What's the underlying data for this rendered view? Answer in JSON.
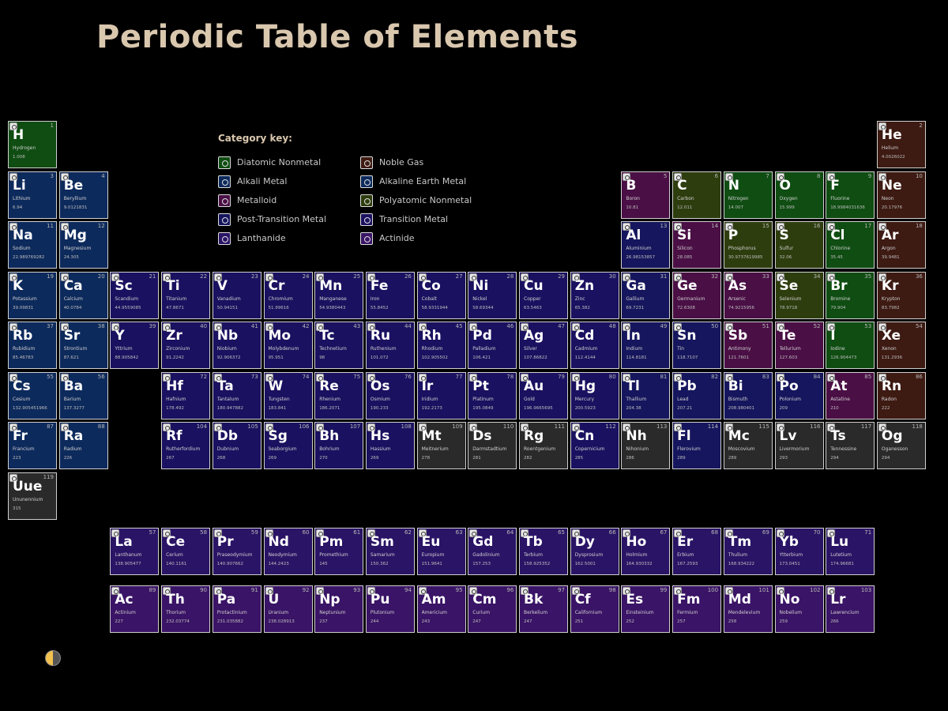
{
  "page": {
    "title": "Periodic Table of Elements"
  },
  "key": {
    "title": "Category key:",
    "items": [
      {
        "id": "dn",
        "label": "Diatomic Nonmetal"
      },
      {
        "id": "am",
        "label": "Alkali Metal"
      },
      {
        "id": "md",
        "label": "Metalloid"
      },
      {
        "id": "pt",
        "label": "Post-Transition Metal"
      },
      {
        "id": "ln",
        "label": "Lanthanide"
      },
      {
        "id": "ng",
        "label": "Noble Gas"
      },
      {
        "id": "ae",
        "label": "Alkaline Earth Metal"
      },
      {
        "id": "pn",
        "label": "Polyatomic Nonmetal"
      },
      {
        "id": "tm",
        "label": "Transition Metal"
      },
      {
        "id": "ac",
        "label": "Actinide"
      }
    ]
  },
  "colors": {
    "dn": "#0f4d12",
    "am": "#0d2a5c",
    "md": "#4a0f45",
    "pt": "#16165e",
    "ln": "#2a1466",
    "ng": "#3d1a12",
    "ae": "#0d2a5c",
    "pn": "#2e3d0e",
    "tm": "#1a1160",
    "ac": "#3a1466",
    "un": "#2a2a2a"
  },
  "elements": [
    {
      "n": 1,
      "s": "H",
      "name": "Hydrogen",
      "mass": "1.008",
      "c": "dn",
      "r": 1,
      "g": 1
    },
    {
      "n": 2,
      "s": "He",
      "name": "Helium",
      "mass": "4.0026022",
      "c": "ng",
      "r": 1,
      "g": 18
    },
    {
      "n": 3,
      "s": "Li",
      "name": "Lithium",
      "mass": "6.94",
      "c": "am",
      "r": 2,
      "g": 1
    },
    {
      "n": 4,
      "s": "Be",
      "name": "Beryllium",
      "mass": "9.0121831",
      "c": "ae",
      "r": 2,
      "g": 2
    },
    {
      "n": 5,
      "s": "B",
      "name": "Boron",
      "mass": "10.81",
      "c": "md",
      "r": 2,
      "g": 13
    },
    {
      "n": 6,
      "s": "C",
      "name": "Carbon",
      "mass": "12.011",
      "c": "pn",
      "r": 2,
      "g": 14
    },
    {
      "n": 7,
      "s": "N",
      "name": "Nitrogen",
      "mass": "14.007",
      "c": "dn",
      "r": 2,
      "g": 15
    },
    {
      "n": 8,
      "s": "O",
      "name": "Oxygen",
      "mass": "15.999",
      "c": "dn",
      "r": 2,
      "g": 16
    },
    {
      "n": 9,
      "s": "F",
      "name": "Fluorine",
      "mass": "18.9984031636",
      "c": "dn",
      "r": 2,
      "g": 17
    },
    {
      "n": 10,
      "s": "Ne",
      "name": "Neon",
      "mass": "20.17976",
      "c": "ng",
      "r": 2,
      "g": 18
    },
    {
      "n": 11,
      "s": "Na",
      "name": "Sodium",
      "mass": "22.989769282",
      "c": "am",
      "r": 3,
      "g": 1
    },
    {
      "n": 12,
      "s": "Mg",
      "name": "Magnesium",
      "mass": "24.305",
      "c": "ae",
      "r": 3,
      "g": 2
    },
    {
      "n": 13,
      "s": "Al",
      "name": "Aluminium",
      "mass": "26.98153857",
      "c": "pt",
      "r": 3,
      "g": 13
    },
    {
      "n": 14,
      "s": "Si",
      "name": "Silicon",
      "mass": "28.085",
      "c": "md",
      "r": 3,
      "g": 14
    },
    {
      "n": 15,
      "s": "P",
      "name": "Phosphorus",
      "mass": "30.9737619985",
      "c": "pn",
      "r": 3,
      "g": 15
    },
    {
      "n": 16,
      "s": "S",
      "name": "Sulfur",
      "mass": "32.06",
      "c": "pn",
      "r": 3,
      "g": 16
    },
    {
      "n": 17,
      "s": "Cl",
      "name": "Chlorine",
      "mass": "35.45",
      "c": "dn",
      "r": 3,
      "g": 17
    },
    {
      "n": 18,
      "s": "Ar",
      "name": "Argon",
      "mass": "39.9481",
      "c": "ng",
      "r": 3,
      "g": 18
    },
    {
      "n": 19,
      "s": "K",
      "name": "Potassium",
      "mass": "39.09831",
      "c": "am",
      "r": 4,
      "g": 1
    },
    {
      "n": 20,
      "s": "Ca",
      "name": "Calcium",
      "mass": "40.0784",
      "c": "ae",
      "r": 4,
      "g": 2
    },
    {
      "n": 21,
      "s": "Sc",
      "name": "Scandium",
      "mass": "44.9559085",
      "c": "tm",
      "r": 4,
      "g": 3
    },
    {
      "n": 22,
      "s": "Ti",
      "name": "Titanium",
      "mass": "47.8671",
      "c": "tm",
      "r": 4,
      "g": 4
    },
    {
      "n": 23,
      "s": "V",
      "name": "Vanadium",
      "mass": "50.94151",
      "c": "tm",
      "r": 4,
      "g": 5
    },
    {
      "n": 24,
      "s": "Cr",
      "name": "Chromium",
      "mass": "51.99616",
      "c": "tm",
      "r": 4,
      "g": 6
    },
    {
      "n": 25,
      "s": "Mn",
      "name": "Manganese",
      "mass": "54.9380443",
      "c": "tm",
      "r": 4,
      "g": 7
    },
    {
      "n": 26,
      "s": "Fe",
      "name": "Iron",
      "mass": "55.8452",
      "c": "tm",
      "r": 4,
      "g": 8
    },
    {
      "n": 27,
      "s": "Co",
      "name": "Cobalt",
      "mass": "58.9331944",
      "c": "tm",
      "r": 4,
      "g": 9
    },
    {
      "n": 28,
      "s": "Ni",
      "name": "Nickel",
      "mass": "58.69344",
      "c": "tm",
      "r": 4,
      "g": 10
    },
    {
      "n": 29,
      "s": "Cu",
      "name": "Copper",
      "mass": "63.5463",
      "c": "tm",
      "r": 4,
      "g": 11
    },
    {
      "n": 30,
      "s": "Zn",
      "name": "Zinc",
      "mass": "65.382",
      "c": "tm",
      "r": 4,
      "g": 12
    },
    {
      "n": 31,
      "s": "Ga",
      "name": "Gallium",
      "mass": "69.7231",
      "c": "pt",
      "r": 4,
      "g": 13
    },
    {
      "n": 32,
      "s": "Ge",
      "name": "Germanium",
      "mass": "72.6308",
      "c": "md",
      "r": 4,
      "g": 14
    },
    {
      "n": 33,
      "s": "As",
      "name": "Arsenic",
      "mass": "74.9215956",
      "c": "md",
      "r": 4,
      "g": 15
    },
    {
      "n": 34,
      "s": "Se",
      "name": "Selenium",
      "mass": "78.9718",
      "c": "pn",
      "r": 4,
      "g": 16
    },
    {
      "n": 35,
      "s": "Br",
      "name": "Bromine",
      "mass": "79.904",
      "c": "dn",
      "r": 4,
      "g": 17
    },
    {
      "n": 36,
      "s": "Kr",
      "name": "Krypton",
      "mass": "83.7982",
      "c": "ng",
      "r": 4,
      "g": 18
    },
    {
      "n": 37,
      "s": "Rb",
      "name": "Rubidium",
      "mass": "85.46783",
      "c": "am",
      "r": 5,
      "g": 1
    },
    {
      "n": 38,
      "s": "Sr",
      "name": "Strontium",
      "mass": "87.621",
      "c": "ae",
      "r": 5,
      "g": 2
    },
    {
      "n": 39,
      "s": "Y",
      "name": "Yttrium",
      "mass": "88.905842",
      "c": "tm",
      "r": 5,
      "g": 3
    },
    {
      "n": 40,
      "s": "Zr",
      "name": "Zirconium",
      "mass": "91.2242",
      "c": "tm",
      "r": 5,
      "g": 4
    },
    {
      "n": 41,
      "s": "Nb",
      "name": "Niobium",
      "mass": "92.906372",
      "c": "tm",
      "r": 5,
      "g": 5
    },
    {
      "n": 42,
      "s": "Mo",
      "name": "Molybdenum",
      "mass": "95.951",
      "c": "tm",
      "r": 5,
      "g": 6
    },
    {
      "n": 43,
      "s": "Tc",
      "name": "Technetium",
      "mass": "98",
      "c": "tm",
      "r": 5,
      "g": 7
    },
    {
      "n": 44,
      "s": "Ru",
      "name": "Ruthenium",
      "mass": "101.072",
      "c": "tm",
      "r": 5,
      "g": 8
    },
    {
      "n": 45,
      "s": "Rh",
      "name": "Rhodium",
      "mass": "102.905502",
      "c": "tm",
      "r": 5,
      "g": 9
    },
    {
      "n": 46,
      "s": "Pd",
      "name": "Palladium",
      "mass": "106.421",
      "c": "tm",
      "r": 5,
      "g": 10
    },
    {
      "n": 47,
      "s": "Ag",
      "name": "Silver",
      "mass": "107.86822",
      "c": "tm",
      "r": 5,
      "g": 11
    },
    {
      "n": 48,
      "s": "Cd",
      "name": "Cadmium",
      "mass": "112.4144",
      "c": "tm",
      "r": 5,
      "g": 12
    },
    {
      "n": 49,
      "s": "In",
      "name": "Indium",
      "mass": "114.8181",
      "c": "pt",
      "r": 5,
      "g": 13
    },
    {
      "n": 50,
      "s": "Sn",
      "name": "Tin",
      "mass": "118.7107",
      "c": "pt",
      "r": 5,
      "g": 14
    },
    {
      "n": 51,
      "s": "Sb",
      "name": "Antimony",
      "mass": "121.7601",
      "c": "md",
      "r": 5,
      "g": 15
    },
    {
      "n": 52,
      "s": "Te",
      "name": "Tellurium",
      "mass": "127.603",
      "c": "md",
      "r": 5,
      "g": 16
    },
    {
      "n": 53,
      "s": "I",
      "name": "Iodine",
      "mass": "126.904473",
      "c": "dn",
      "r": 5,
      "g": 17
    },
    {
      "n": 54,
      "s": "Xe",
      "name": "Xenon",
      "mass": "131.2936",
      "c": "ng",
      "r": 5,
      "g": 18
    },
    {
      "n": 55,
      "s": "Cs",
      "name": "Cesium",
      "mass": "132.905451966",
      "c": "am",
      "r": 6,
      "g": 1
    },
    {
      "n": 56,
      "s": "Ba",
      "name": "Barium",
      "mass": "137.3277",
      "c": "ae",
      "r": 6,
      "g": 2
    },
    {
      "n": 72,
      "s": "Hf",
      "name": "Hafnium",
      "mass": "178.492",
      "c": "tm",
      "r": 6,
      "g": 4
    },
    {
      "n": 73,
      "s": "Ta",
      "name": "Tantalum",
      "mass": "180.947882",
      "c": "tm",
      "r": 6,
      "g": 5
    },
    {
      "n": 74,
      "s": "W",
      "name": "Tungsten",
      "mass": "183.841",
      "c": "tm",
      "r": 6,
      "g": 6
    },
    {
      "n": 75,
      "s": "Re",
      "name": "Rhenium",
      "mass": "186.2071",
      "c": "tm",
      "r": 6,
      "g": 7
    },
    {
      "n": 76,
      "s": "Os",
      "name": "Osmium",
      "mass": "190.233",
      "c": "tm",
      "r": 6,
      "g": 8
    },
    {
      "n": 77,
      "s": "Ir",
      "name": "Iridium",
      "mass": "192.2173",
      "c": "tm",
      "r": 6,
      "g": 9
    },
    {
      "n": 78,
      "s": "Pt",
      "name": "Platinum",
      "mass": "195.0849",
      "c": "tm",
      "r": 6,
      "g": 10
    },
    {
      "n": 79,
      "s": "Au",
      "name": "Gold",
      "mass": "196.9665695",
      "c": "tm",
      "r": 6,
      "g": 11
    },
    {
      "n": 80,
      "s": "Hg",
      "name": "Mercury",
      "mass": "200.5923",
      "c": "tm",
      "r": 6,
      "g": 12
    },
    {
      "n": 81,
      "s": "Tl",
      "name": "Thallium",
      "mass": "204.38",
      "c": "pt",
      "r": 6,
      "g": 13
    },
    {
      "n": 82,
      "s": "Pb",
      "name": "Lead",
      "mass": "207.21",
      "c": "pt",
      "r": 6,
      "g": 14
    },
    {
      "n": 83,
      "s": "Bi",
      "name": "Bismuth",
      "mass": "208.980401",
      "c": "pt",
      "r": 6,
      "g": 15
    },
    {
      "n": 84,
      "s": "Po",
      "name": "Polonium",
      "mass": "209",
      "c": "pt",
      "r": 6,
      "g": 16
    },
    {
      "n": 85,
      "s": "At",
      "name": "Astatine",
      "mass": "210",
      "c": "md",
      "r": 6,
      "g": 17
    },
    {
      "n": 86,
      "s": "Rn",
      "name": "Radon",
      "mass": "222",
      "c": "ng",
      "r": 6,
      "g": 18
    },
    {
      "n": 87,
      "s": "Fr",
      "name": "Francium",
      "mass": "223",
      "c": "am",
      "r": 7,
      "g": 1
    },
    {
      "n": 88,
      "s": "Ra",
      "name": "Radium",
      "mass": "226",
      "c": "ae",
      "r": 7,
      "g": 2
    },
    {
      "n": 104,
      "s": "Rf",
      "name": "Rutherfordium",
      "mass": "267",
      "c": "tm",
      "r": 7,
      "g": 4
    },
    {
      "n": 105,
      "s": "Db",
      "name": "Dubnium",
      "mass": "268",
      "c": "tm",
      "r": 7,
      "g": 5
    },
    {
      "n": 106,
      "s": "Sg",
      "name": "Seaborgium",
      "mass": "269",
      "c": "tm",
      "r": 7,
      "g": 6
    },
    {
      "n": 107,
      "s": "Bh",
      "name": "Bohrium",
      "mass": "270",
      "c": "tm",
      "r": 7,
      "g": 7
    },
    {
      "n": 108,
      "s": "Hs",
      "name": "Hassium",
      "mass": "269",
      "c": "tm",
      "r": 7,
      "g": 8
    },
    {
      "n": 109,
      "s": "Mt",
      "name": "Meitnerium",
      "mass": "278",
      "c": "un",
      "r": 7,
      "g": 9
    },
    {
      "n": 110,
      "s": "Ds",
      "name": "Darmstadtium",
      "mass": "281",
      "c": "un",
      "r": 7,
      "g": 10
    },
    {
      "n": 111,
      "s": "Rg",
      "name": "Roentgenium",
      "mass": "282",
      "c": "un",
      "r": 7,
      "g": 11
    },
    {
      "n": 112,
      "s": "Cn",
      "name": "Copernicium",
      "mass": "285",
      "c": "tm",
      "r": 7,
      "g": 12
    },
    {
      "n": 113,
      "s": "Nh",
      "name": "Nihonium",
      "mass": "286",
      "c": "un",
      "r": 7,
      "g": 13
    },
    {
      "n": 114,
      "s": "Fl",
      "name": "Flerovium",
      "mass": "289",
      "c": "pt",
      "r": 7,
      "g": 14
    },
    {
      "n": 115,
      "s": "Mc",
      "name": "Moscovium",
      "mass": "289",
      "c": "un",
      "r": 7,
      "g": 15
    },
    {
      "n": 116,
      "s": "Lv",
      "name": "Livermorium",
      "mass": "293",
      "c": "un",
      "r": 7,
      "g": 16
    },
    {
      "n": 117,
      "s": "Ts",
      "name": "Tennessine",
      "mass": "294",
      "c": "un",
      "r": 7,
      "g": 17
    },
    {
      "n": 118,
      "s": "Og",
      "name": "Oganesson",
      "mass": "294",
      "c": "un",
      "r": 7,
      "g": 18
    },
    {
      "n": 119,
      "s": "Uue",
      "name": "Ununennium",
      "mass": "315",
      "c": "un",
      "r": 8,
      "g": 1
    },
    {
      "n": 57,
      "s": "La",
      "name": "Lanthanum",
      "mass": "138.905477",
      "c": "ln",
      "r": 9,
      "g": 3
    },
    {
      "n": 58,
      "s": "Ce",
      "name": "Cerium",
      "mass": "140.1161",
      "c": "ln",
      "r": 9,
      "g": 4
    },
    {
      "n": 59,
      "s": "Pr",
      "name": "Praseodymium",
      "mass": "140.907662",
      "c": "ln",
      "r": 9,
      "g": 5
    },
    {
      "n": 60,
      "s": "Nd",
      "name": "Neodymium",
      "mass": "144.2423",
      "c": "ln",
      "r": 9,
      "g": 6
    },
    {
      "n": 61,
      "s": "Pm",
      "name": "Promethium",
      "mass": "145",
      "c": "ln",
      "r": 9,
      "g": 7
    },
    {
      "n": 62,
      "s": "Sm",
      "name": "Samarium",
      "mass": "150.362",
      "c": "ln",
      "r": 9,
      "g": 8
    },
    {
      "n": 63,
      "s": "Eu",
      "name": "Europium",
      "mass": "151.9641",
      "c": "ln",
      "r": 9,
      "g": 9
    },
    {
      "n": 64,
      "s": "Gd",
      "name": "Gadolinium",
      "mass": "157.253",
      "c": "ln",
      "r": 9,
      "g": 10
    },
    {
      "n": 65,
      "s": "Tb",
      "name": "Terbium",
      "mass": "158.925352",
      "c": "ln",
      "r": 9,
      "g": 11
    },
    {
      "n": 66,
      "s": "Dy",
      "name": "Dysprosium",
      "mass": "162.5001",
      "c": "ln",
      "r": 9,
      "g": 12
    },
    {
      "n": 67,
      "s": "Ho",
      "name": "Holmium",
      "mass": "164.930332",
      "c": "ln",
      "r": 9,
      "g": 13
    },
    {
      "n": 68,
      "s": "Er",
      "name": "Erbium",
      "mass": "167.2593",
      "c": "ln",
      "r": 9,
      "g": 14
    },
    {
      "n": 69,
      "s": "Tm",
      "name": "Thulium",
      "mass": "168.934222",
      "c": "ln",
      "r": 9,
      "g": 15
    },
    {
      "n": 70,
      "s": "Yb",
      "name": "Ytterbium",
      "mass": "173.0451",
      "c": "ln",
      "r": 9,
      "g": 16
    },
    {
      "n": 71,
      "s": "Lu",
      "name": "Lutetium",
      "mass": "174.96681",
      "c": "ln",
      "r": 9,
      "g": 17
    },
    {
      "n": 89,
      "s": "Ac",
      "name": "Actinium",
      "mass": "227",
      "c": "ac",
      "r": 10,
      "g": 3
    },
    {
      "n": 90,
      "s": "Th",
      "name": "Thorium",
      "mass": "232.03774",
      "c": "ac",
      "r": 10,
      "g": 4
    },
    {
      "n": 91,
      "s": "Pa",
      "name": "Protactinium",
      "mass": "231.035882",
      "c": "ac",
      "r": 10,
      "g": 5
    },
    {
      "n": 92,
      "s": "U",
      "name": "Uranium",
      "mass": "238.028913",
      "c": "ac",
      "r": 10,
      "g": 6
    },
    {
      "n": 93,
      "s": "Np",
      "name": "Neptunium",
      "mass": "237",
      "c": "ac",
      "r": 10,
      "g": 7
    },
    {
      "n": 94,
      "s": "Pu",
      "name": "Plutonium",
      "mass": "244",
      "c": "ac",
      "r": 10,
      "g": 8
    },
    {
      "n": 95,
      "s": "Am",
      "name": "Americium",
      "mass": "243",
      "c": "ac",
      "r": 10,
      "g": 9
    },
    {
      "n": 96,
      "s": "Cm",
      "name": "Curium",
      "mass": "247",
      "c": "ac",
      "r": 10,
      "g": 10
    },
    {
      "n": 97,
      "s": "Bk",
      "name": "Berkelium",
      "mass": "247",
      "c": "ac",
      "r": 10,
      "g": 11
    },
    {
      "n": 98,
      "s": "Cf",
      "name": "Californium",
      "mass": "251",
      "c": "ac",
      "r": 10,
      "g": 12
    },
    {
      "n": 99,
      "s": "Es",
      "name": "Einsteinium",
      "mass": "252",
      "c": "ac",
      "r": 10,
      "g": 13
    },
    {
      "n": 100,
      "s": "Fm",
      "name": "Fermium",
      "mass": "257",
      "c": "ac",
      "r": 10,
      "g": 14
    },
    {
      "n": 101,
      "s": "Md",
      "name": "Mendelevium",
      "mass": "258",
      "c": "ac",
      "r": 10,
      "g": 15
    },
    {
      "n": 102,
      "s": "No",
      "name": "Nobelium",
      "mass": "259",
      "c": "ac",
      "r": 10,
      "g": 16
    },
    {
      "n": 103,
      "s": "Lr",
      "name": "Lawrencium",
      "mass": "266",
      "c": "ac",
      "r": 10,
      "g": 17
    }
  ]
}
